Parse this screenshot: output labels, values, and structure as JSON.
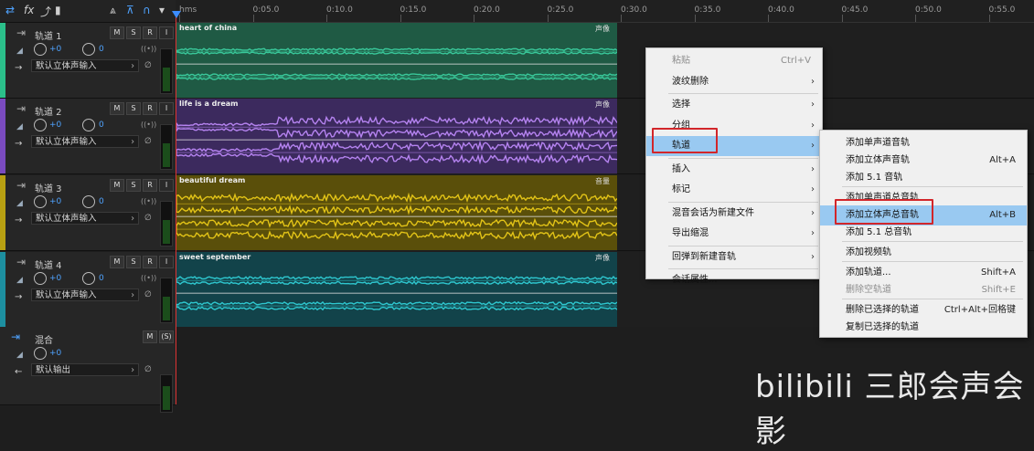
{
  "ruler": {
    "ticks": [
      "hms",
      "0:05.0",
      "0:10.0",
      "0:15.0",
      "0:20.0",
      "0:25.0",
      "0:30.0",
      "0:35.0",
      "0:40.0",
      "0:45.0",
      "0:50.0",
      "0:55.0"
    ]
  },
  "tracks": [
    {
      "name": "轨道 1",
      "volume": "+0",
      "pan": "0",
      "input": "默认立体声输入",
      "clip": "heart of china",
      "clip_tag": "声像",
      "color": "#2bbf8a",
      "clip_bg": "#1f5a44",
      "wave": "#39c89a"
    },
    {
      "name": "轨道 2",
      "volume": "+0",
      "pan": "0",
      "input": "默认立体声输入",
      "clip": "life is a dream",
      "clip_tag": "声像",
      "color": "#7a4bbf",
      "clip_bg": "#3c2a5e",
      "wave": "#b583f0"
    },
    {
      "name": "轨道 3",
      "volume": "+0",
      "pan": "0",
      "input": "默认立体声输入",
      "clip": "beautiful dream",
      "clip_tag": "音量",
      "color": "#b8a012",
      "clip_bg": "#5a4f0a",
      "wave": "#e2c317"
    },
    {
      "name": "轨道 4",
      "volume": "+0",
      "pan": "0",
      "input": "默认立体声输入",
      "clip": "sweet september",
      "clip_tag": "声像",
      "color": "#1d8fa0",
      "clip_bg": "#12434a",
      "wave": "#2ec7cf"
    }
  ],
  "mix": {
    "name": "混合",
    "volume": "+0",
    "output": "默认输出",
    "m": "M",
    "s": "(S)"
  },
  "track_buttons": {
    "m": "M",
    "s": "S",
    "r": "R",
    "i": "I"
  },
  "main_menu": [
    {
      "label": "粘贴",
      "shortcut": "Ctrl+V",
      "disabled": true
    },
    {
      "label": "波纹删除",
      "arrow": "›"
    },
    {
      "label": "选择",
      "arrow": "›"
    },
    {
      "label": "分组",
      "arrow": "›"
    },
    {
      "label": "轨道",
      "arrow": "›",
      "highlighted": true
    },
    {
      "label": "插入",
      "arrow": "›"
    },
    {
      "label": "标记",
      "arrow": "›"
    },
    {
      "label": "混音会话为新建文件",
      "arrow": "›"
    },
    {
      "label": "导出缩混",
      "arrow": "›"
    },
    {
      "label": "回弹到新建音轨",
      "arrow": "›"
    },
    {
      "label": "会话属性..."
    }
  ],
  "sub_menu": [
    {
      "label": "添加单声道音轨"
    },
    {
      "label": "添加立体声音轨",
      "shortcut": "Alt+A"
    },
    {
      "label": "添加 5.1 音轨"
    },
    {
      "label": "添加单声道总音轨"
    },
    {
      "label": "添加立体声总音轨",
      "shortcut": "Alt+B",
      "highlighted": true
    },
    {
      "label": "添加 5.1 总音轨"
    },
    {
      "label": "添加视频轨"
    },
    {
      "label": "添加轨道...",
      "shortcut": "Shift+A"
    },
    {
      "label": "删除空轨道",
      "shortcut": "Shift+E",
      "disabled": true
    },
    {
      "label": "删除已选择的轨道",
      "shortcut": "Ctrl+Alt+回格键"
    },
    {
      "label": "复制已选择的轨道"
    }
  ],
  "watermark": "bilibili 三郎会声会影"
}
